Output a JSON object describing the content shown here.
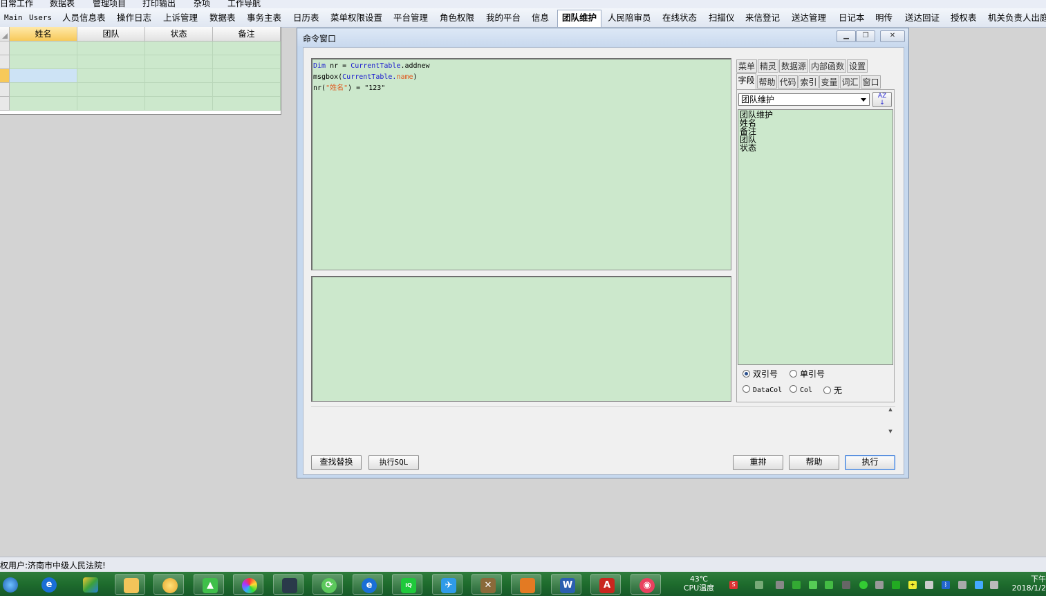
{
  "menubar": [
    "日常工作",
    "数据表",
    "管理项目",
    "打印输出",
    "杂项",
    "工作导航"
  ],
  "tabs": [
    {
      "label": "Main",
      "mono": true
    },
    {
      "label": "Users",
      "mono": true
    },
    {
      "label": "人员信息表"
    },
    {
      "label": "操作日志"
    },
    {
      "label": "上诉管理"
    },
    {
      "label": "数据表"
    },
    {
      "label": "事务主表"
    },
    {
      "label": "日历表"
    },
    {
      "label": "菜单权限设置"
    },
    {
      "label": "平台管理"
    },
    {
      "label": "角色权限"
    },
    {
      "label": "我的平台"
    },
    {
      "label": "信息"
    },
    {
      "label": "团队维护",
      "active": true
    },
    {
      "label": "人民陪审员"
    },
    {
      "label": "在线状态"
    },
    {
      "label": "扫描仪"
    },
    {
      "label": "来信登记"
    },
    {
      "label": "送达管理"
    },
    {
      "label": "日记本"
    },
    {
      "label": "明传"
    },
    {
      "label": "送达回证"
    },
    {
      "label": "授权表"
    },
    {
      "label": "机关负责人出庭"
    }
  ],
  "grid": {
    "columns": [
      "姓名",
      "团队",
      "状态",
      "备注"
    ],
    "selected_column": 0,
    "current_row": 2,
    "row_count": 5
  },
  "cmd": {
    "title": "命令窗口",
    "code": {
      "l1_kw": "Dim",
      "l1_mid": " nr = ",
      "l1_obj": "CurrentTable",
      "l1_end": ".addnew",
      "l2_start": "msgbox(",
      "l2_obj": "CurrentTable",
      "l2_dot": ".",
      "l2_prop": "name",
      "l2_end": ")",
      "l3_start": "nr(",
      "l3_key": "\"姓名\"",
      "l3_end": ") = \"123\""
    },
    "right_tabs_row1": [
      "菜单",
      "精灵",
      "数据源",
      "内部函数",
      "设置"
    ],
    "right_tabs_row2": [
      "字段",
      "帮助",
      "代码",
      "索引",
      "变量",
      "词汇",
      "窗口"
    ],
    "active_right_tab": "字段",
    "combo_value": "团队维护",
    "sort_icon_text": "AZ",
    "fields": [
      "团队维护",
      "姓名",
      "备注",
      "团队",
      "状态"
    ],
    "quote_options": [
      {
        "label": "双引号",
        "checked": true
      },
      {
        "label": "单引号",
        "checked": false
      }
    ],
    "col_options": [
      {
        "label": "DataCol",
        "checked": false
      },
      {
        "label": "Col",
        "checked": false
      },
      {
        "label": "无",
        "checked": false
      }
    ],
    "buttons": {
      "find_replace": "查找替换",
      "exec_sql": "执行SQL",
      "reset": "重排",
      "help": "帮助",
      "execute": "执行"
    }
  },
  "status": {
    "text": "权用户:济南市中级人民法院!"
  },
  "taskbar": {
    "cpu_temp": "43℃",
    "cpu_label": "CPU温度",
    "clock_line1": "下午",
    "clock_line2": "2018/1/2"
  },
  "colors": {
    "grid_green": "#cce8cc",
    "accent_blue": "#1b1bcf",
    "keyword_orange": "#e05a20",
    "taskbar_green": "#1d6a2c"
  }
}
